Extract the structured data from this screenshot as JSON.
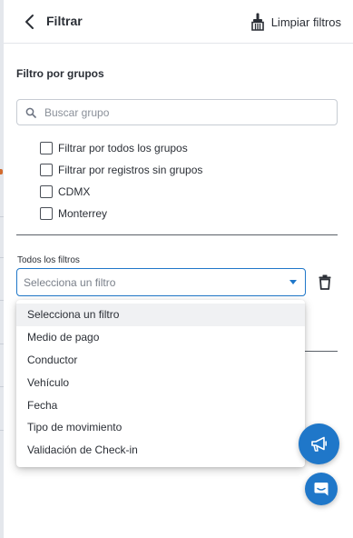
{
  "header": {
    "title": "Filtrar",
    "clear_label": "Limpiar filtros"
  },
  "groups": {
    "section_title": "Filtro por grupos",
    "search_placeholder": "Buscar grupo",
    "options": [
      "Filtrar por todos los grupos",
      "Filtrar por registros sin grupos",
      "CDMX",
      "Monterrey"
    ]
  },
  "filters": {
    "label": "Todos los filtros",
    "selected": "Selecciona un filtro",
    "options": [
      "Selecciona un filtro",
      "Medio de pago",
      "Conductor",
      "Vehículo",
      "Fecha",
      "Tipo de movimiento",
      "Validación de Check-in"
    ]
  },
  "colors": {
    "accent": "#1f77c9",
    "text": "#2b2f36",
    "highlight": "#f0f1f3"
  },
  "icons": {
    "back": "chevron-left-icon",
    "clear": "broom-icon",
    "search": "search-icon",
    "trash": "trash-icon",
    "announce": "megaphone-icon",
    "chat": "chat-icon"
  }
}
